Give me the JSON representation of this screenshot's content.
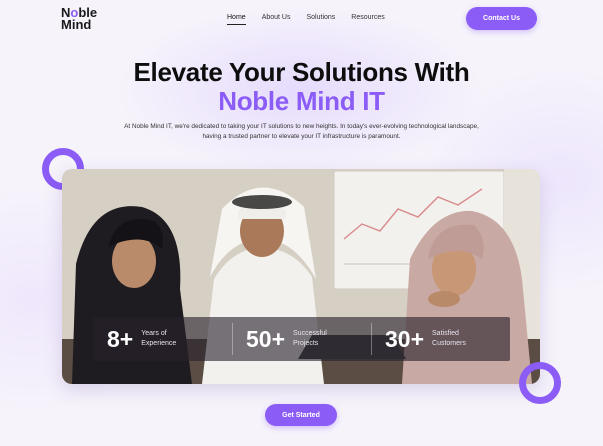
{
  "brand": {
    "logo_line1_pre": "N",
    "logo_line1_o": "o",
    "logo_line1_post": "ble",
    "logo_line2": "Mind",
    "accent_color": "#8b5cf6"
  },
  "nav": {
    "items": [
      {
        "label": "Home",
        "active": true
      },
      {
        "label": "About Us",
        "active": false
      },
      {
        "label": "Solutions",
        "active": false
      },
      {
        "label": "Resources",
        "active": false
      }
    ],
    "contact_label": "Contact Us"
  },
  "hero": {
    "title_line1": "Elevate Your Solutions With",
    "title_line2": "Noble Mind IT",
    "description": "At Noble Mind IT, we're dedicated to taking your IT solutions to new heights. In today's ever-evolving technological landscape, having a trusted partner to elevate your IT infrastructure is paramount."
  },
  "stats": [
    {
      "value": "8+",
      "label": "Years of Experience"
    },
    {
      "value": "50+",
      "label": "Successful Projects"
    },
    {
      "value": "30+",
      "label": "Satisfied Customers"
    }
  ],
  "cta": {
    "label": "Get Started"
  }
}
